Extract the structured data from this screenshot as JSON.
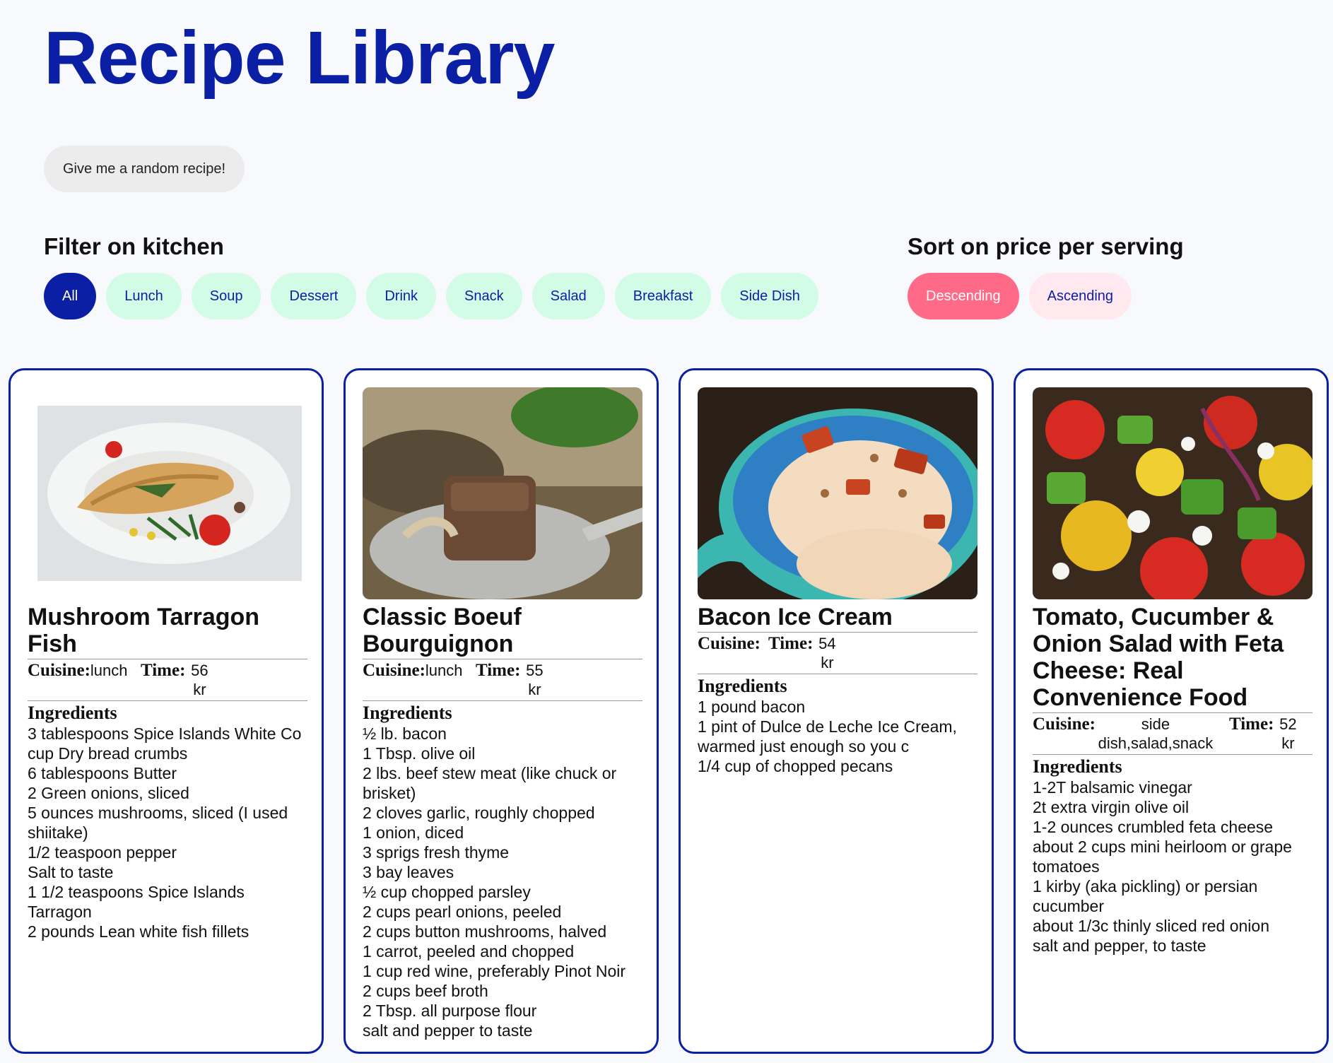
{
  "page": {
    "title": "Recipe Library"
  },
  "random_button": {
    "label": "Give me a random recipe!"
  },
  "filter": {
    "heading": "Filter on kitchen",
    "options": [
      "All",
      "Lunch",
      "Soup",
      "Dessert",
      "Drink",
      "Snack",
      "Salad",
      "Breakfast",
      "Side Dish"
    ],
    "selected": "All"
  },
  "sort": {
    "heading": "Sort on price per serving",
    "options": [
      "Descending",
      "Ascending"
    ],
    "selected": "Descending"
  },
  "labels": {
    "cuisine": "Cuisine:",
    "time": "Time:",
    "ingredients": "Ingredients",
    "currency": "kr"
  },
  "colors": {
    "brand": "#0a1fa3",
    "chip_bg": "#d2fce5",
    "sort_active": "#ff6a88",
    "sort_inactive": "#ffe8ee"
  },
  "recipes": [
    {
      "title": "Mushroom Tarragon Fish",
      "cuisine": "lunch",
      "time": "56",
      "image": "fish-fillet-photo",
      "ingredients": [
        "3 tablespoons Spice Islands White Co",
        "cup Dry bread crumbs",
        "6 tablespoons Butter",
        "2 Green onions, sliced",
        "5 ounces mushrooms, sliced (I used shiitake)",
        "1/2 teaspoon pepper",
        "Salt to taste",
        "1 1/2 teaspoons Spice Islands Tarragon",
        "2 pounds Lean white fish fillets"
      ]
    },
    {
      "title": "Classic Boeuf Bourguignon",
      "cuisine": "lunch",
      "time": "55",
      "image": "beef-stew-photo",
      "ingredients": [
        "½ lb. bacon",
        "1 Tbsp. olive oil",
        "2 lbs. beef stew meat (like chuck or brisket)",
        "2 cloves garlic, roughly chopped",
        "1 onion, diced",
        "3 sprigs fresh thyme",
        "3 bay leaves",
        "½ cup chopped parsley",
        "2 cups pearl onions, peeled",
        "2 cups button mushrooms, halved",
        "1 carrot, peeled and chopped",
        "1 cup red wine, preferably Pinot Noir",
        "2 cups beef broth",
        "2 Tbsp. all purpose flour",
        "salt and pepper to taste"
      ]
    },
    {
      "title": "Bacon Ice Cream",
      "cuisine": "",
      "time": "54",
      "image": "ice-cream-photo",
      "ingredients": [
        "1 pound bacon",
        "1 pint of Dulce de Leche Ice Cream, warmed just enough so you c",
        "1/4 cup of chopped pecans"
      ]
    },
    {
      "title": "Tomato, Cucumber & Onion Salad with Feta Cheese: Real Convenience Food",
      "cuisine": "side dish,salad,snack",
      "time": "52",
      "image": "tomato-salad-photo",
      "ingredients": [
        "1-2T balsamic vinegar",
        "2t extra virgin olive oil",
        "1-2 ounces crumbled feta cheese",
        "about 2 cups mini heirloom or grape tomatoes",
        "1 kirby (aka pickling) or persian cucumber",
        "about 1/3c thinly sliced red onion",
        "salt and pepper, to taste"
      ]
    }
  ]
}
